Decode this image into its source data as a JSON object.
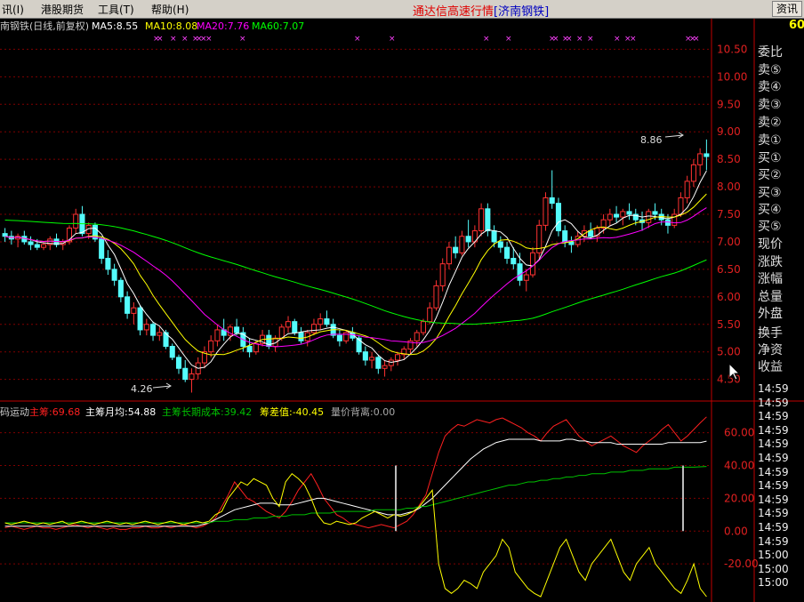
{
  "menu": {
    "items": [
      "讯(I)",
      "港股期货",
      "工具(T)",
      "帮助(H)"
    ],
    "title": "通达信高速行情",
    "stock": "[济南钢铁]",
    "right_button": "资讯"
  },
  "main_panel": {
    "name_label": "南钢铁(日线,前复权)",
    "ma_labels": [
      {
        "text": "MA5:8.55",
        "color": "#ffffff"
      },
      {
        "text": "MA10:8.08",
        "color": "#ffff00"
      },
      {
        "text": "MA20:7.76",
        "color": "#ff00ff"
      },
      {
        "text": "MA60:7.07",
        "color": "#00ff00"
      }
    ],
    "y_ticks": [
      10.5,
      10.0,
      9.5,
      9.0,
      8.5,
      8.0,
      7.5,
      7.0,
      6.5,
      6.0,
      5.5,
      5.0,
      4.5
    ],
    "y_tick_labels": [
      "10.50",
      "10.00",
      "9.50",
      "9.00",
      "8.50",
      "8.00",
      "7.50",
      "7.00",
      "6.50",
      "6.00",
      "5.50",
      "5.00",
      "4.50"
    ],
    "high_label": "8.86",
    "low_label": "4.26"
  },
  "indicator_panel": {
    "labels": [
      {
        "text": "码运动",
        "color": "#cccccc"
      },
      {
        "text": "主筹:69.68",
        "color": "#ff2020"
      },
      {
        "text": "主筹月均:54.88",
        "color": "#ffffff"
      },
      {
        "text": "主筹长期成本:39.42",
        "color": "#00c000"
      },
      {
        "text": "筹差值:-40.45",
        "color": "#ffff00"
      },
      {
        "text": "量价背离:0.00",
        "color": "#aaaaaa"
      }
    ],
    "y_tick_labels": [
      "60.00",
      "40.00",
      "20.00",
      "0.00",
      "-20.00"
    ]
  },
  "sidebar": {
    "top_badge": "60",
    "labels": [
      "委比",
      "卖⑤",
      "卖④",
      "卖③",
      "卖②",
      "卖①",
      "买①",
      "买②",
      "买③",
      "买④",
      "买⑤",
      "现价",
      "涨跌",
      "涨幅",
      "总量",
      "外盘",
      "换手",
      "净资",
      "收益"
    ],
    "times": [
      "14:59",
      "14:59",
      "14:59",
      "14:59",
      "14:59",
      "14:59",
      "14:59",
      "14:59",
      "14:59",
      "14:59",
      "14:59",
      "14:59",
      "15:00",
      "15:00",
      "15:00"
    ]
  },
  "chart_data": {
    "type": "candlestick",
    "candles": [
      [
        7.15,
        7.25,
        7.0,
        7.1
      ],
      [
        7.1,
        7.2,
        6.95,
        7.05
      ],
      [
        7.05,
        7.15,
        6.9,
        7.1
      ],
      [
        7.1,
        7.2,
        6.95,
        7.0
      ],
      [
        7.0,
        7.1,
        6.85,
        6.95
      ],
      [
        6.95,
        7.05,
        6.85,
        6.9
      ],
      [
        6.9,
        7.0,
        6.85,
        6.95
      ],
      [
        6.95,
        7.1,
        6.85,
        7.05
      ],
      [
        7.05,
        7.15,
        6.9,
        6.95
      ],
      [
        6.95,
        7.05,
        6.85,
        7.0
      ],
      [
        7.0,
        7.3,
        6.95,
        7.25
      ],
      [
        7.25,
        7.6,
        7.15,
        7.5
      ],
      [
        7.5,
        7.65,
        7.1,
        7.15
      ],
      [
        7.15,
        7.35,
        7.05,
        7.3
      ],
      [
        7.3,
        7.35,
        7.0,
        7.05
      ],
      [
        7.05,
        7.1,
        6.6,
        6.7
      ],
      [
        6.7,
        6.85,
        6.4,
        6.5
      ],
      [
        6.5,
        6.6,
        6.2,
        6.3
      ],
      [
        6.3,
        6.35,
        5.9,
        6.0
      ],
      [
        6.0,
        6.1,
        5.6,
        5.7
      ],
      [
        5.7,
        5.9,
        5.5,
        5.8
      ],
      [
        5.8,
        5.85,
        5.3,
        5.4
      ],
      [
        5.4,
        5.6,
        5.3,
        5.5
      ],
      [
        5.5,
        5.55,
        5.2,
        5.3
      ],
      [
        5.3,
        5.45,
        5.2,
        5.35
      ],
      [
        5.35,
        5.4,
        5.05,
        5.1
      ],
      [
        5.1,
        5.15,
        4.85,
        4.9
      ],
      [
        4.9,
        4.95,
        4.6,
        4.7
      ],
      [
        4.7,
        4.85,
        4.45,
        4.5
      ],
      [
        4.5,
        4.7,
        4.26,
        4.6
      ],
      [
        4.6,
        4.9,
        4.5,
        4.8
      ],
      [
        4.8,
        5.1,
        4.7,
        5.0
      ],
      [
        5.0,
        5.3,
        4.9,
        5.2
      ],
      [
        5.2,
        5.5,
        5.1,
        5.4
      ],
      [
        5.4,
        5.6,
        5.2,
        5.3
      ],
      [
        5.3,
        5.5,
        5.2,
        5.45
      ],
      [
        5.45,
        5.6,
        5.3,
        5.35
      ],
      [
        5.35,
        5.45,
        5.0,
        5.1
      ],
      [
        5.1,
        5.25,
        4.9,
        5.0
      ],
      [
        5.0,
        5.2,
        4.95,
        5.15
      ],
      [
        5.15,
        5.4,
        5.1,
        5.3
      ],
      [
        5.3,
        5.4,
        5.05,
        5.1
      ],
      [
        5.1,
        5.3,
        5.0,
        5.25
      ],
      [
        5.25,
        5.5,
        5.2,
        5.45
      ],
      [
        5.45,
        5.65,
        5.35,
        5.55
      ],
      [
        5.55,
        5.6,
        5.3,
        5.35
      ],
      [
        5.35,
        5.45,
        5.15,
        5.2
      ],
      [
        5.2,
        5.4,
        5.1,
        5.35
      ],
      [
        5.35,
        5.6,
        5.3,
        5.5
      ],
      [
        5.5,
        5.7,
        5.4,
        5.6
      ],
      [
        5.6,
        5.75,
        5.45,
        5.5
      ],
      [
        5.5,
        5.6,
        5.25,
        5.3
      ],
      [
        5.3,
        5.4,
        5.1,
        5.2
      ],
      [
        5.2,
        5.4,
        5.15,
        5.35
      ],
      [
        5.35,
        5.45,
        5.2,
        5.25
      ],
      [
        5.25,
        5.3,
        4.95,
        5.0
      ],
      [
        5.0,
        5.1,
        4.75,
        4.85
      ],
      [
        4.85,
        5.0,
        4.7,
        4.9
      ],
      [
        4.9,
        4.95,
        4.6,
        4.7
      ],
      [
        4.7,
        4.85,
        4.55,
        4.75
      ],
      [
        4.75,
        4.9,
        4.65,
        4.85
      ],
      [
        4.85,
        5.0,
        4.75,
        4.95
      ],
      [
        4.95,
        5.1,
        4.85,
        5.05
      ],
      [
        5.05,
        5.25,
        4.95,
        5.2
      ],
      [
        5.2,
        5.4,
        5.1,
        5.35
      ],
      [
        5.35,
        5.6,
        5.3,
        5.55
      ],
      [
        5.55,
        5.9,
        5.5,
        5.8
      ],
      [
        5.8,
        6.3,
        5.75,
        6.2
      ],
      [
        6.2,
        6.7,
        6.1,
        6.6
      ],
      [
        6.6,
        7.0,
        6.5,
        6.9
      ],
      [
        6.9,
        7.1,
        6.7,
        6.8
      ],
      [
        6.8,
        7.2,
        6.75,
        7.1
      ],
      [
        7.1,
        7.4,
        6.9,
        7.0
      ],
      [
        7.0,
        7.3,
        6.9,
        7.2
      ],
      [
        7.2,
        7.7,
        7.1,
        7.6
      ],
      [
        7.6,
        7.7,
        7.1,
        7.2
      ],
      [
        7.2,
        7.3,
        6.9,
        7.0
      ],
      [
        7.0,
        7.1,
        6.8,
        6.9
      ],
      [
        6.9,
        7.0,
        6.6,
        6.7
      ],
      [
        6.7,
        6.9,
        6.5,
        6.6
      ],
      [
        6.6,
        6.8,
        6.2,
        6.3
      ],
      [
        6.3,
        6.5,
        6.1,
        6.4
      ],
      [
        6.4,
        6.9,
        6.35,
        6.8
      ],
      [
        6.8,
        7.4,
        6.7,
        7.3
      ],
      [
        7.3,
        7.9,
        7.2,
        7.8
      ],
      [
        7.8,
        8.3,
        7.6,
        7.7
      ],
      [
        7.7,
        7.8,
        7.1,
        7.2
      ],
      [
        7.2,
        7.3,
        6.9,
        7.0
      ],
      [
        7.0,
        7.1,
        6.8,
        6.95
      ],
      [
        6.95,
        7.2,
        6.9,
        7.1
      ],
      [
        7.1,
        7.3,
        7.0,
        7.2
      ],
      [
        7.2,
        7.35,
        7.05,
        7.1
      ],
      [
        7.1,
        7.3,
        7.0,
        7.25
      ],
      [
        7.25,
        7.5,
        7.15,
        7.4
      ],
      [
        7.4,
        7.6,
        7.3,
        7.5
      ],
      [
        7.5,
        7.65,
        7.35,
        7.45
      ],
      [
        7.45,
        7.6,
        7.3,
        7.55
      ],
      [
        7.55,
        7.7,
        7.4,
        7.5
      ],
      [
        7.5,
        7.6,
        7.3,
        7.4
      ],
      [
        7.4,
        7.55,
        7.2,
        7.35
      ],
      [
        7.35,
        7.6,
        7.25,
        7.55
      ],
      [
        7.55,
        7.7,
        7.4,
        7.5
      ],
      [
        7.5,
        7.6,
        7.3,
        7.4
      ],
      [
        7.4,
        7.5,
        7.15,
        7.3
      ],
      [
        7.3,
        7.6,
        7.25,
        7.5
      ],
      [
        7.5,
        7.9,
        7.45,
        7.8
      ],
      [
        7.8,
        8.2,
        7.7,
        8.1
      ],
      [
        8.1,
        8.5,
        8.0,
        8.4
      ],
      [
        8.4,
        8.7,
        8.2,
        8.6
      ],
      [
        8.6,
        8.86,
        8.3,
        8.55
      ]
    ],
    "ma": [
      {
        "name": "MA5",
        "color": "#ffffff",
        "period": 5
      },
      {
        "name": "MA10",
        "color": "#ffff00",
        "period": 10
      },
      {
        "name": "MA20",
        "color": "#ff00ff",
        "period": 20
      },
      {
        "name": "MA60",
        "color": "#00ff00",
        "period": 60
      }
    ],
    "ylim": [
      4.3,
      10.7
    ],
    "indicator": {
      "ylim": [
        -40,
        75
      ],
      "series": [
        {
          "name": "主筹",
          "color": "#ff2020",
          "values": [
            2,
            3,
            2,
            1,
            2,
            3,
            2,
            2,
            1,
            2,
            3,
            4,
            3,
            2,
            3,
            2,
            1,
            2,
            1,
            1,
            2,
            2,
            3,
            2,
            2,
            3,
            2,
            3,
            4,
            3,
            2,
            3,
            5,
            8,
            15,
            22,
            30,
            25,
            20,
            18,
            15,
            12,
            10,
            8,
            12,
            18,
            25,
            30,
            35,
            28,
            20,
            15,
            10,
            8,
            5,
            4,
            3,
            2,
            3,
            4,
            3,
            2,
            4,
            6,
            10,
            16,
            22,
            35,
            48,
            58,
            62,
            65,
            64,
            66,
            68,
            67,
            66,
            68,
            69,
            67,
            65,
            63,
            60,
            58,
            55,
            60,
            64,
            66,
            68,
            63,
            58,
            55,
            52,
            54,
            56,
            58,
            55,
            52,
            50,
            48,
            52,
            55,
            58,
            62,
            65,
            60,
            55,
            58,
            62,
            66,
            69.68
          ]
        },
        {
          "name": "主筹月均",
          "color": "#ffffff",
          "values": [
            3,
            3,
            3,
            3,
            3,
            3,
            3,
            3,
            3,
            3,
            3,
            3,
            3,
            3,
            3,
            3,
            3,
            3,
            3,
            3,
            3,
            3,
            3,
            3,
            3,
            3,
            3,
            3,
            3,
            3,
            3,
            4,
            5,
            7,
            9,
            11,
            13,
            14,
            15,
            16,
            17,
            17,
            17,
            16,
            16,
            16,
            17,
            18,
            19,
            20,
            20,
            19,
            18,
            17,
            16,
            15,
            14,
            13,
            12,
            11,
            10,
            10,
            10,
            11,
            12,
            14,
            17,
            20,
            24,
            28,
            32,
            36,
            40,
            44,
            47,
            50,
            52,
            54,
            55,
            56,
            56,
            56,
            56,
            56,
            55,
            55,
            55,
            55,
            56,
            56,
            55,
            55,
            54,
            54,
            54,
            54,
            53,
            53,
            53,
            53,
            53,
            53,
            53,
            53,
            54,
            54,
            54,
            54,
            54,
            54,
            54.88
          ]
        },
        {
          "name": "主筹长期成本",
          "color": "#00c000",
          "values": [
            5,
            5,
            5,
            5,
            5,
            5,
            5,
            5,
            5,
            5,
            5,
            5,
            5,
            5,
            5,
            5,
            5,
            5,
            5,
            5,
            5,
            5,
            5,
            5,
            5,
            5,
            5,
            5,
            5,
            5,
            5,
            5,
            5,
            6,
            6,
            6,
            7,
            7,
            7,
            8,
            8,
            8,
            9,
            9,
            9,
            10,
            10,
            10,
            11,
            11,
            11,
            11,
            12,
            12,
            12,
            12,
            12,
            12,
            13,
            13,
            13,
            13,
            13,
            14,
            14,
            15,
            15,
            16,
            17,
            18,
            19,
            20,
            21,
            22,
            23,
            24,
            25,
            26,
            27,
            28,
            28,
            29,
            30,
            30,
            31,
            31,
            32,
            32,
            33,
            33,
            34,
            34,
            35,
            35,
            35,
            36,
            36,
            36,
            37,
            37,
            37,
            38,
            38,
            38,
            38,
            39,
            39,
            39,
            39,
            39.2,
            39.42
          ]
        },
        {
          "name": "筹差值",
          "color": "#ffff00",
          "values": [
            5,
            4,
            5,
            6,
            5,
            4,
            5,
            4,
            5,
            6,
            4,
            5,
            6,
            5,
            4,
            5,
            6,
            5,
            4,
            5,
            4,
            5,
            6,
            5,
            4,
            5,
            6,
            5,
            4,
            5,
            6,
            5,
            6,
            10,
            12,
            20,
            25,
            30,
            28,
            32,
            30,
            28,
            20,
            15,
            30,
            35,
            32,
            28,
            20,
            10,
            5,
            4,
            6,
            5,
            4,
            5,
            8,
            10,
            12,
            10,
            8,
            10,
            9,
            10,
            12,
            15,
            20,
            25,
            -20,
            -35,
            -38,
            -35,
            -30,
            -32,
            -35,
            -25,
            -20,
            -15,
            -5,
            -10,
            -25,
            -30,
            -35,
            -38,
            -40,
            -30,
            -20,
            -10,
            -5,
            -15,
            -25,
            -30,
            -20,
            -15,
            -10,
            -5,
            -15,
            -25,
            -30,
            -20,
            -15,
            -10,
            -20,
            -25,
            -30,
            -35,
            -38,
            -30,
            -20,
            -35,
            -40.45
          ]
        }
      ]
    }
  }
}
